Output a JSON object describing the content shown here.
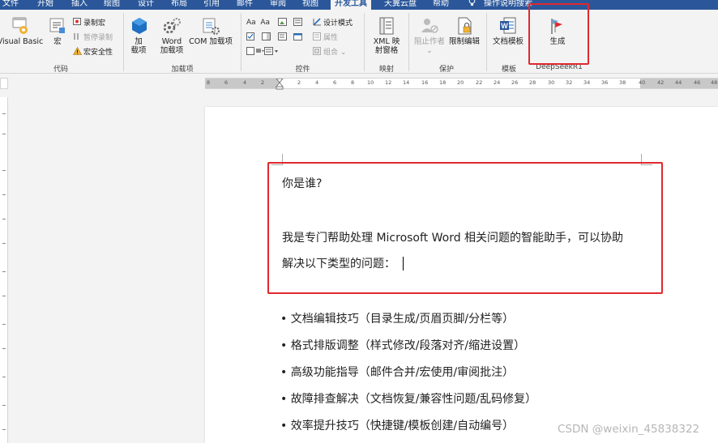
{
  "tabs": [
    "文件",
    "开始",
    "插入",
    "绘图",
    "设计",
    "布局",
    "引用",
    "邮件",
    "审阅",
    "视图",
    "开发工具",
    "天翼云盘",
    "帮助",
    "操作说明搜索"
  ],
  "active_tab": "开发工具",
  "ribbon": {
    "code": {
      "label": "代码",
      "visual_basic": "Visual Basic",
      "macros": "宏",
      "record_macro": "录制宏",
      "pause_recording": "暂停录制",
      "macro_security": "宏安全性"
    },
    "addins": {
      "label": "加载项",
      "addins_line1": "加",
      "addins_line2": "载项",
      "word_addins_line1": "Word",
      "word_addins_line2": "加载项",
      "com_addins": "COM 加载项"
    },
    "controls": {
      "label": "控件",
      "design_mode": "设计模式",
      "properties": "属性",
      "group": "组合"
    },
    "mapping": {
      "label": "映射",
      "xml_line1": "XML 映",
      "xml_line2": "射窗格"
    },
    "protect": {
      "label": "保护",
      "block_authors": "阻止作者",
      "restrict_editing": "限制编辑"
    },
    "templates": {
      "label": "模板",
      "document_template": "文档模板"
    },
    "deepseek": {
      "label": "DeepSeekR1",
      "generate": "生成"
    }
  },
  "ruler_numbers": [
    "8",
    "6",
    "4",
    "2",
    "2",
    "4",
    "6",
    "8",
    "10",
    "12",
    "14",
    "16",
    "18",
    "20",
    "22",
    "24",
    "26",
    "28",
    "30",
    "32",
    "34",
    "36",
    "38",
    "40",
    "42",
    "44",
    "46",
    "48"
  ],
  "document": {
    "question": "你是谁?",
    "answer_line1": "我是专门帮助处理 Microsoft Word 相关问题的智能助手，可以协助",
    "answer_line2": "解决以下类型的问题：",
    "bullets": [
      "• 文档编辑技巧（目录生成/页眉页脚/分栏等）",
      "• 格式排版调整（样式修改/段落对齐/缩进设置）",
      "• 高级功能指导（邮件合并/宏使用/审阅批注）",
      "• 故障排查解决（文档恢复/兼容性问题/乱码修复）",
      "• 效率提升技巧（快捷键/模板创建/自动编号）"
    ]
  },
  "watermark": "CSDN @weixin_45838322",
  "colors": {
    "title_bar": "#2b579a",
    "highlight": "#e0282e",
    "ribbon_bg": "#f3f3f3"
  }
}
